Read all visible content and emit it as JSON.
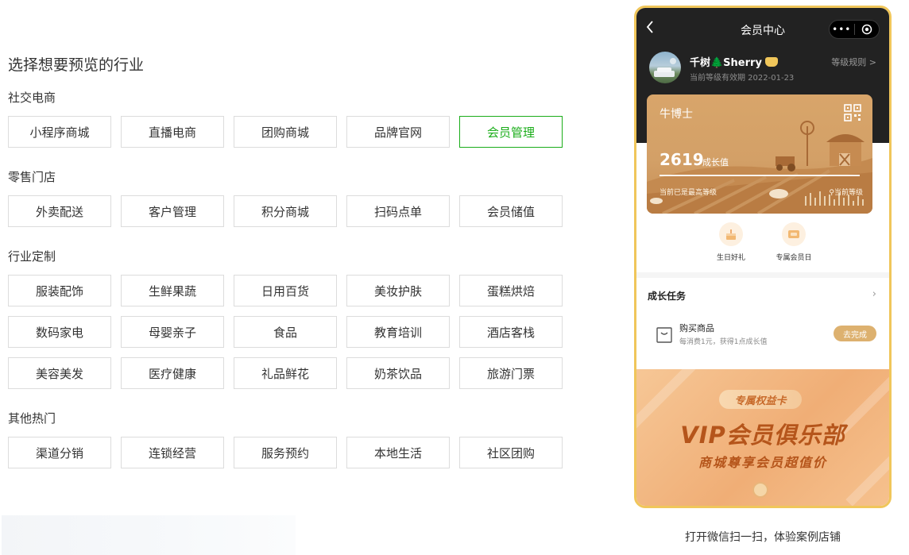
{
  "left_panel": {
    "page_title": "选择想要预览的行业",
    "sections": [
      {
        "title": "社交电商",
        "items": [
          "小程序商城",
          "直播电商",
          "团购商城",
          "品牌官网",
          "会员管理"
        ],
        "active": "会员管理"
      },
      {
        "title": "零售门店",
        "items": [
          "外卖配送",
          "客户管理",
          "积分商城",
          "扫码点单",
          "会员储值"
        ]
      },
      {
        "title": "行业定制",
        "items": [
          "服装配饰",
          "生鲜果蔬",
          "日用百货",
          "美妆护肤",
          "蛋糕烘焙",
          "数码家电",
          "母婴亲子",
          "食品",
          "教育培训",
          "酒店客栈",
          "美容美发",
          "医疗健康",
          "礼品鲜花",
          "奶茶饮品",
          "旅游门票"
        ]
      },
      {
        "title": "其他热门",
        "items": [
          "渠道分销",
          "连锁经营",
          "服务预约",
          "本地生活",
          "社区团购"
        ]
      }
    ]
  },
  "phone": {
    "nav": {
      "back_icon": "chevron-left-icon",
      "title": "会员中心",
      "more_icon": "more-dots-icon",
      "close_icon": "target-icon"
    },
    "user": {
      "name": "千树🌲Sherry",
      "validity": "当前等级有效期 2022-01-23",
      "level_rule": "等级规则 >"
    },
    "card": {
      "level": "牛博士",
      "value": "2619",
      "value_unit": "成长值",
      "hint": "当前已是最高等级",
      "current": "当前等级",
      "progress": 1.0
    },
    "perks": [
      {
        "label": "生日好礼",
        "icon": "cake-icon"
      },
      {
        "label": "专属会员日",
        "icon": "vip-card-icon"
      }
    ],
    "tasks": {
      "title": "成长任务",
      "items": [
        {
          "name": "购买商品",
          "desc": "每消费1元，获得1点成长值",
          "button": "去完成"
        }
      ]
    },
    "banner": {
      "tag": "专属权益卡",
      "title": "VIP会员俱乐部",
      "subtitle": "商城尊享会员超值价"
    }
  },
  "footer": {
    "scan_caption": "打开微信扫一扫，体验案例店铺"
  },
  "colors": {
    "accent_green": "#1aad19",
    "phone_frame": "#f0c65a",
    "card_gold": "#d3a067",
    "banner_orange": "#f0ae76"
  }
}
